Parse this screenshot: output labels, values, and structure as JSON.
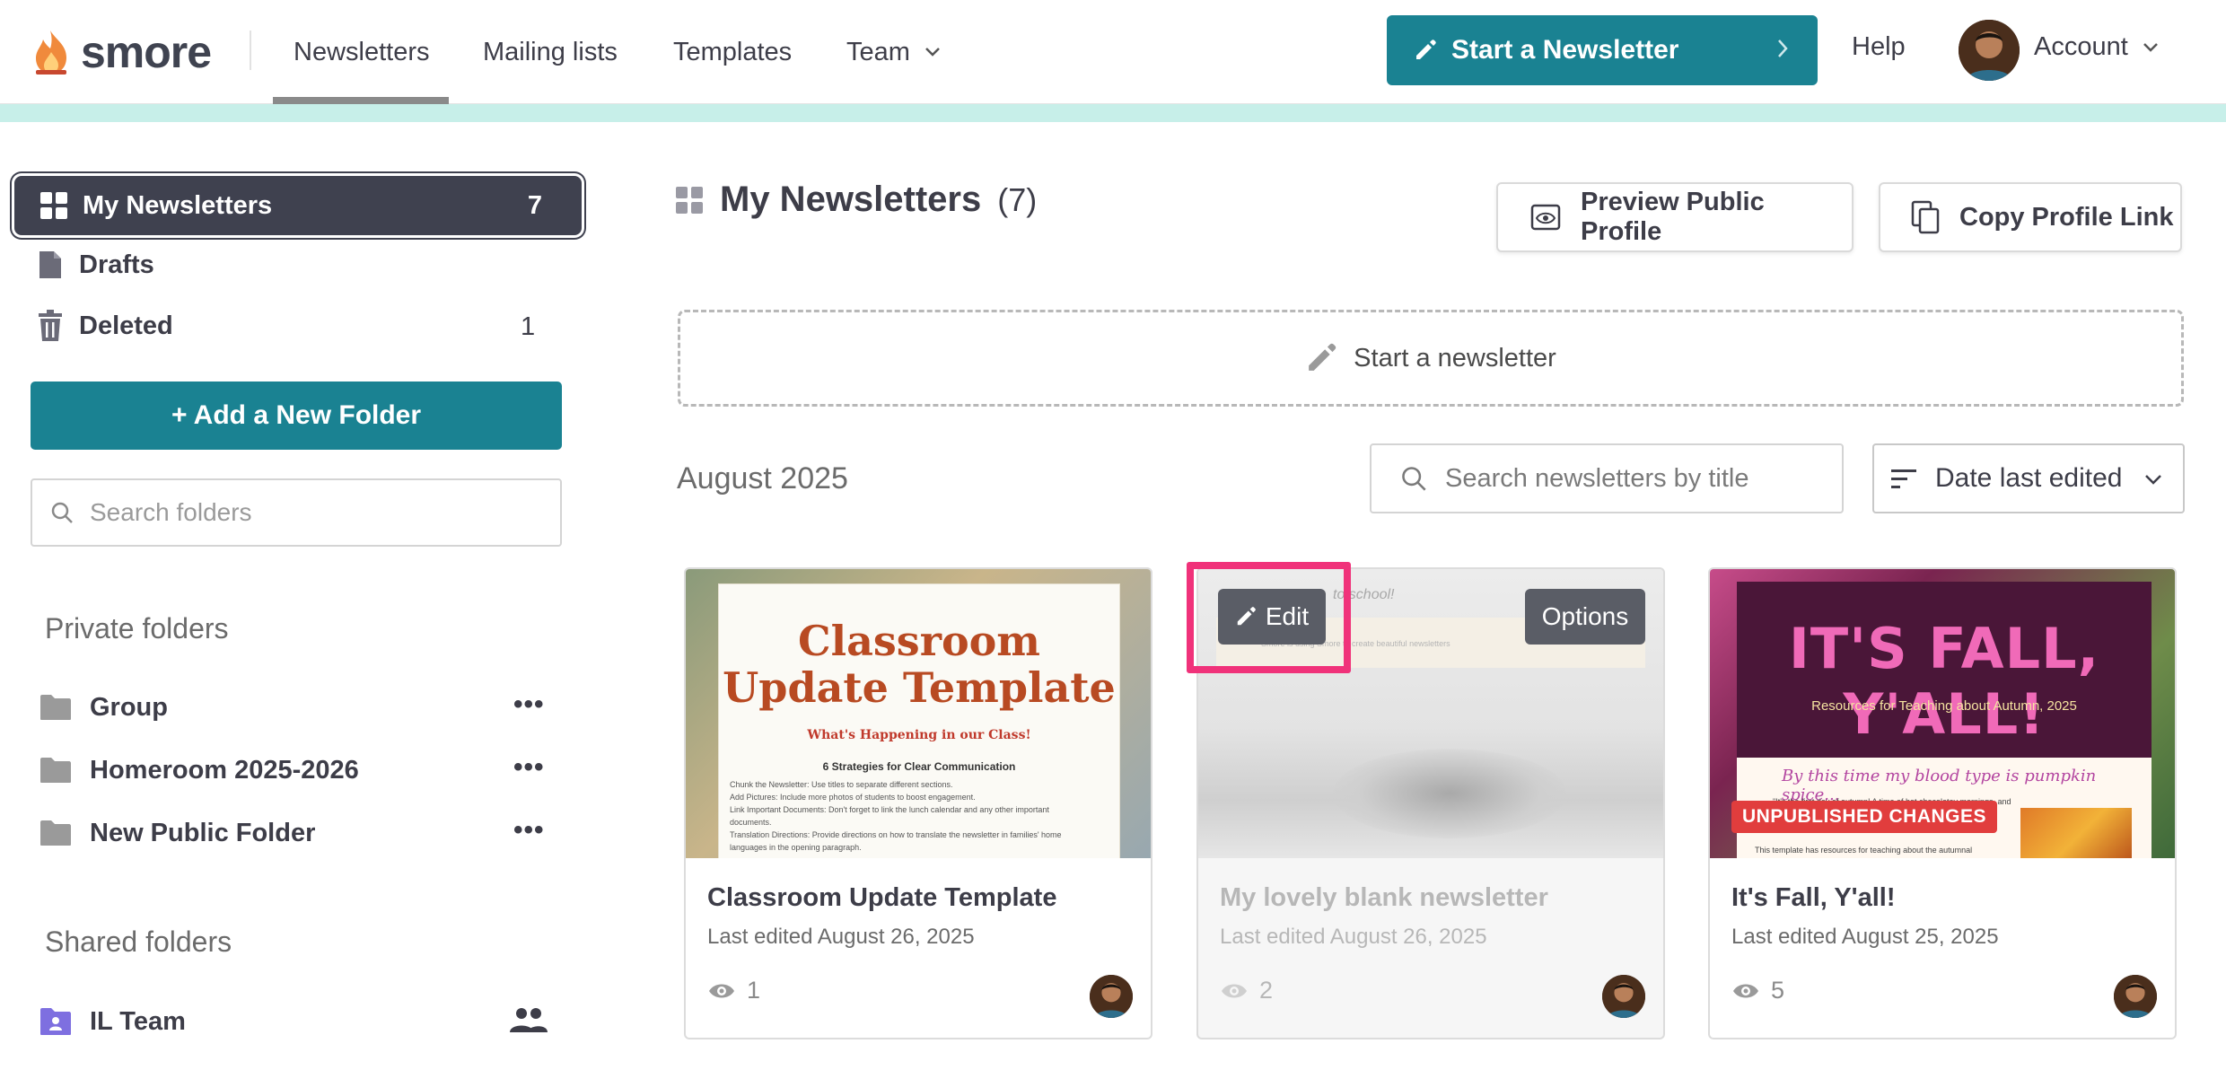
{
  "header": {
    "logo_text": "smore",
    "nav": [
      {
        "label": "Newsletters",
        "active": true
      },
      {
        "label": "Mailing lists"
      },
      {
        "label": "Templates"
      },
      {
        "label": "Team"
      }
    ],
    "start_button": "Start a Newsletter",
    "help": "Help",
    "account": "Account",
    "accent_color": "#1a8292"
  },
  "sidebar": {
    "active": {
      "label": "My Newsletters",
      "count": "7"
    },
    "items": [
      {
        "label": "Drafts",
        "count": ""
      },
      {
        "label": "Deleted",
        "count": "1"
      }
    ],
    "add_folder_button": "+ Add a New Folder",
    "search_placeholder": "Search folders",
    "private_label": "Private folders",
    "private_folders": [
      "Group",
      "Homeroom 2025-2026",
      "New Public Folder"
    ],
    "shared_label": "Shared folders",
    "shared_folders": [
      "IL Team"
    ]
  },
  "main": {
    "title": "My Newsletters",
    "count": "(7)",
    "preview_button": "Preview Public Profile",
    "copy_button": "Copy Profile Link",
    "start_newsletter": "Start a newsletter",
    "month": "August 2025",
    "search_placeholder": "Search newsletters by title",
    "sort_label": "Date last edited",
    "cards": [
      {
        "title": "Classroom Update Template",
        "date": "Last edited August 26, 2025",
        "views": "1",
        "thumb_heading_1": "Classroom",
        "thumb_heading_2": "Update Template",
        "thumb_sub": "What's Happening in our Class!",
        "thumb_section": "6 Strategies for Clear Communication",
        "thumb_lines": [
          "Chunk the Newsletter: Use titles to separate different sections.",
          "Add Pictures: Include more photos of students to boost engagement.",
          "Link Important Documents: Don't forget to link the lunch calendar and any other important",
          "documents.",
          "Translation Directions: Provide directions on how to translate the newsletter in families' home",
          "languages in the opening paragraph."
        ]
      },
      {
        "title": "My lovely blank newsletter",
        "date": "Last edited August 26, 2025",
        "views": "2",
        "edit_label": "Edit",
        "options_label": "Options",
        "thumb_text": "to school!",
        "thumb_small": "Smore is using Smore to create beautiful newsletters"
      },
      {
        "title": "It's Fall, Y'all!",
        "date": "Last edited August 25, 2025",
        "views": "5",
        "thumb_heading": "IT'S FALL, Y'ALL!",
        "thumb_sub": "Resources for Teaching about Autumn, 2025",
        "thumb_script": "By this time my blood type is pumpkin spice...",
        "thumb_line_1": "\"It's the first day of autumn! A time of hot chocolatey mornings, and",
        "thumb_line_2": "This template has resources for teaching about the autumnal",
        "badge": "UNPUBLISHED CHANGES",
        "badge_color": "#e13d3d"
      }
    ]
  },
  "highlight_color": "#f0327a"
}
